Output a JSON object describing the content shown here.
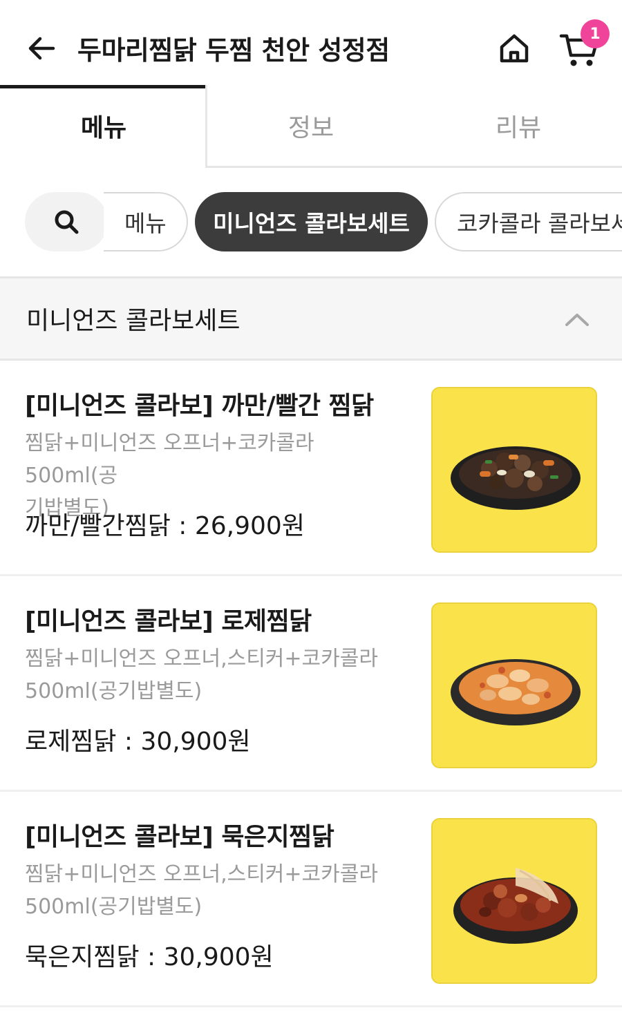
{
  "header": {
    "title": "두마리찜닭 두찜 천안 성정점",
    "back_icon": "arrow-left-icon",
    "home_icon": "home-icon",
    "cart_icon": "cart-icon",
    "cart_count": "1",
    "badge_color": "#f0449a"
  },
  "tabs": [
    {
      "label": "메뉴",
      "active": true
    },
    {
      "label": "정보",
      "active": false
    },
    {
      "label": "리뷰",
      "active": false
    }
  ],
  "chips": {
    "search_icon": "search-icon",
    "items": [
      {
        "label": "메뉴",
        "selected": false
      },
      {
        "label": "미니언즈 콜라보세트",
        "selected": true
      },
      {
        "label": "코카콜라 콜라보세트",
        "selected": false
      }
    ]
  },
  "section": {
    "title": "미니언즈 콜라보세트",
    "toggle_icon": "chevron-up-icon"
  },
  "items": [
    {
      "name": "[미니언즈 콜라보] 까만/빨간 찜닭",
      "desc_line1": "찜닭+미니언즈 오프너+코카콜라 500ml(공",
      "desc_line2": "기밥별도)",
      "price": "까만/빨간찜닭 : 26,900원",
      "image": "dark-jjimdak-dish-image"
    },
    {
      "name": "[미니언즈 콜라보] 로제찜닭",
      "desc_line1": "찜닭+미니언즈 오프너,스티커+코카콜라",
      "desc_line2": "500ml(공기밥별도)",
      "price": "로제찜닭 : 30,900원",
      "image": "rose-jjimdak-dish-image"
    },
    {
      "name": "[미니언즈 콜라보] 묵은지찜닭",
      "desc_line1": "찜닭+미니언즈 오프너,스티커+코카콜라",
      "desc_line2": "500ml(공기밥별도)",
      "price": "묵은지찜닭 : 30,900원",
      "image": "kimchi-jjimdak-dish-image"
    }
  ],
  "colors": {
    "accent_yellow": "#fae34a",
    "chip_selected": "#3c3c3c",
    "muted_text": "#9a9a9a"
  }
}
